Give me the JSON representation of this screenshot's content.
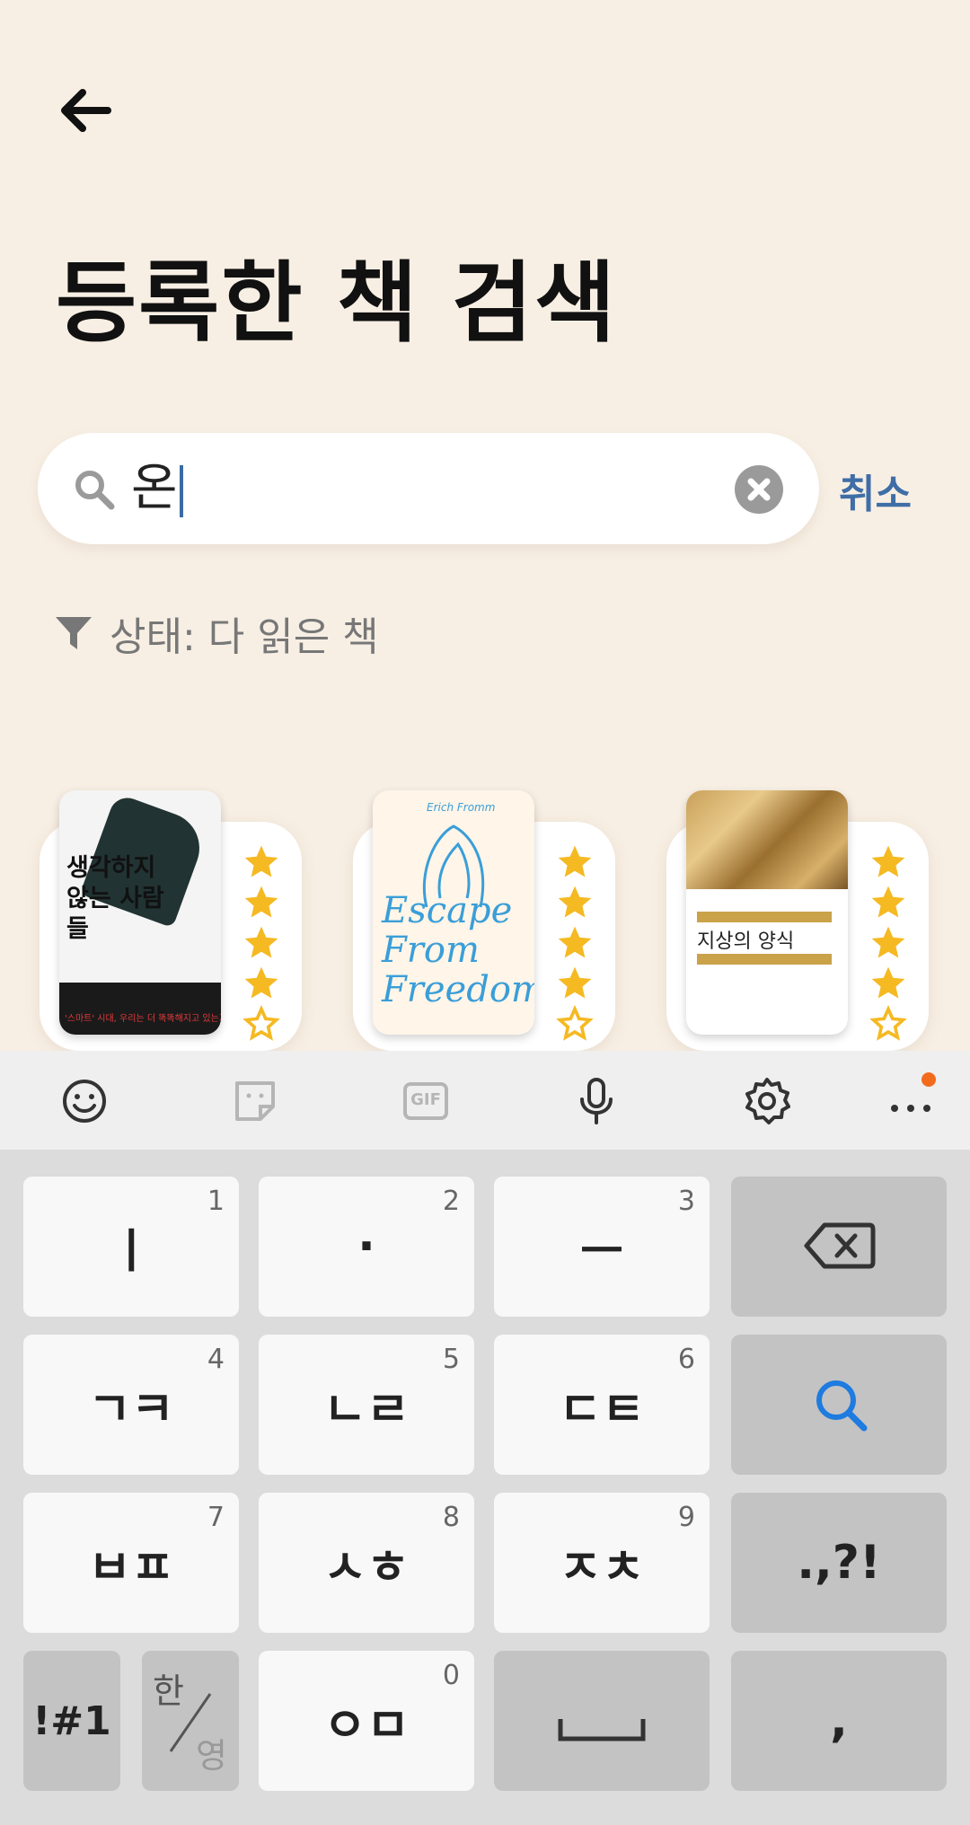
{
  "header": {
    "title": "등록한 책 검색"
  },
  "search": {
    "query": "온",
    "cancel_label": "취소"
  },
  "filter": {
    "label": "상태: 다 읽은 책"
  },
  "books": [
    {
      "cover_title": "생각하지 않는 사람들",
      "cover_tagline": "'스마트' 시대, 우리는 더 똑똑해지고 있는가?",
      "rating": 4
    },
    {
      "cover_title": "Escape From Freedom",
      "cover_author": "Erich Fromm",
      "rating": 4
    },
    {
      "cover_title": "지상의 양식",
      "rating": 4
    }
  ],
  "colors": {
    "background": "#f8efe4",
    "accent": "#3f6ea6",
    "star": "#f5b922"
  },
  "keyboard": {
    "toolbar": [
      "emoji-icon",
      "sticker-icon",
      "gif-icon",
      "mic-icon",
      "settings-icon",
      "more-icon"
    ],
    "gif_label": "GIF",
    "keys": [
      {
        "label": "ㅣ",
        "num": "1"
      },
      {
        "label": "·",
        "num": "2"
      },
      {
        "label": "ㅡ",
        "num": "3"
      },
      {
        "label": "ㄱㅋ",
        "num": "4"
      },
      {
        "label": "ㄴㄹ",
        "num": "5"
      },
      {
        "label": "ㄷㅌ",
        "num": "6"
      },
      {
        "label": "ㅂㅍ",
        "num": "7"
      },
      {
        "label": "ㅅㅎ",
        "num": "8"
      },
      {
        "label": "ㅈㅊ",
        "num": "9"
      },
      {
        "label": "ㅇㅁ",
        "num": "0"
      }
    ],
    "punct_label": ".,?!",
    "symbols_label": "!#1",
    "lang_label_top": "한",
    "lang_label_bottom": "영",
    "comma_label": ","
  }
}
